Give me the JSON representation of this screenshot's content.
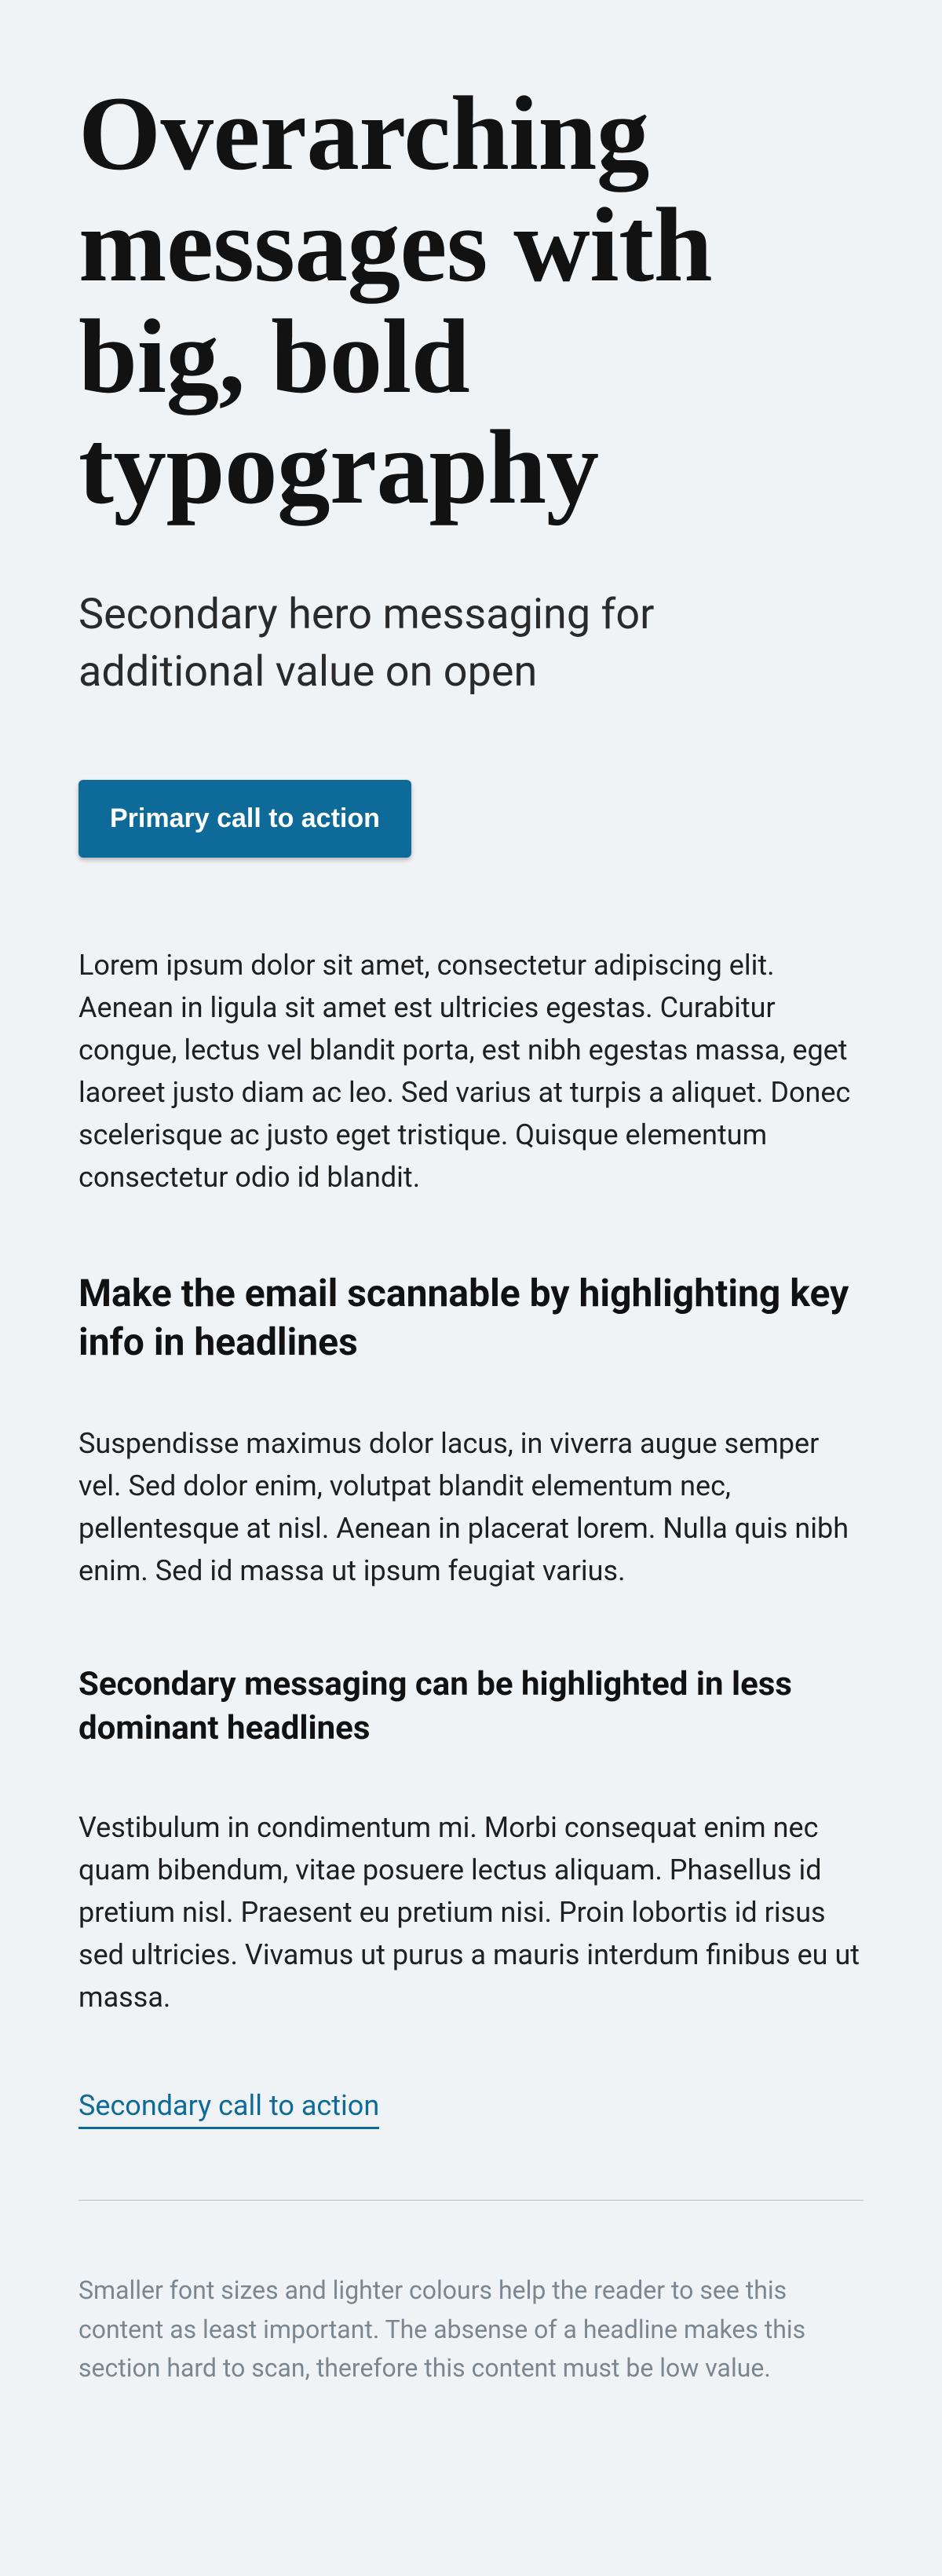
{
  "hero": {
    "title": "Overarching messages with big, bold typography",
    "subtitle": "Secondary hero messaging for additional value on open",
    "primary_cta": "Primary call to action"
  },
  "intro_paragraph": "Lorem ipsum dolor sit amet, consectetur adipiscing elit. Aenean in ligula sit amet est ultricies egestas. Curabitur congue, lectus vel blandit porta, est nibh egestas massa, eget laoreet justo diam ac leo. Sed varius at turpis a aliquet. Donec scelerisque ac justo eget tristique. Quisque elementum consectetur odio id blandit.",
  "section1": {
    "heading": "Make the email scannable by highlighting key info in headlines",
    "body": "Suspendisse maximus dolor lacus, in viverra augue semper vel. Sed dolor enim, volutpat blandit elementum nec, pellentesque at nisl. Aenean in placerat lorem. Nulla quis nibh enim. Sed id massa ut ipsum feugiat varius."
  },
  "section2": {
    "heading": "Secondary messaging can be highlighted in less dominant headlines",
    "body": "Vestibulum in condimentum mi. Morbi consequat enim nec quam bibendum, vitae posuere lectus aliquam. Phasellus id pretium nisl. Praesent eu pretium nisi. Proin lobortis id risus sed ultricies. Vivamus ut purus a mauris interdum finibus eu ut massa."
  },
  "secondary_cta": "Secondary call to action",
  "footer_note": "Smaller font sizes and lighter colours help the reader to see this content as least important. The absense of a headline makes this section hard to scan, therefore this content must be low value."
}
